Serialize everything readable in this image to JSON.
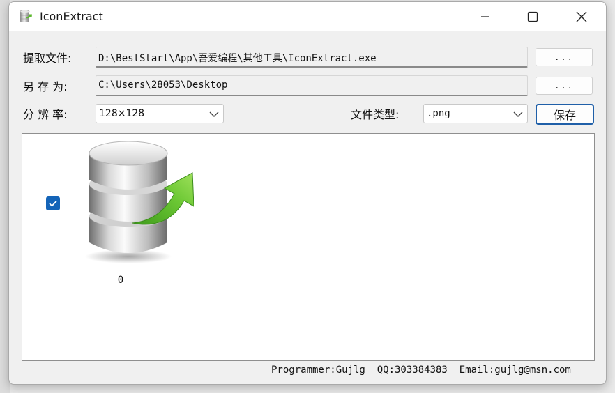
{
  "window": {
    "title": "IconExtract"
  },
  "form": {
    "extract_label": "提取文件:",
    "extract_path": "D:\\BestStart\\App\\吾爱编程\\其他工具\\IconExtract.exe",
    "extract_browse": "...",
    "saveas_label": "另 存 为:",
    "saveas_path": "C:\\Users\\28053\\Desktop",
    "saveas_browse": "...",
    "resolution_label": "分 辨 率:",
    "resolution_value": "128×128",
    "filetype_label": "文件类型:",
    "filetype_value": ".png",
    "save_label": "保存"
  },
  "icons": [
    {
      "index": "0",
      "checked": true,
      "icon": "database-export-icon"
    }
  ],
  "footer": {
    "text": "Programmer:Gujlg  QQ:303384383  Email:gujlg@msn.com"
  },
  "colors": {
    "accent": "#1464b8",
    "arrow_green": "#5cb82e"
  }
}
